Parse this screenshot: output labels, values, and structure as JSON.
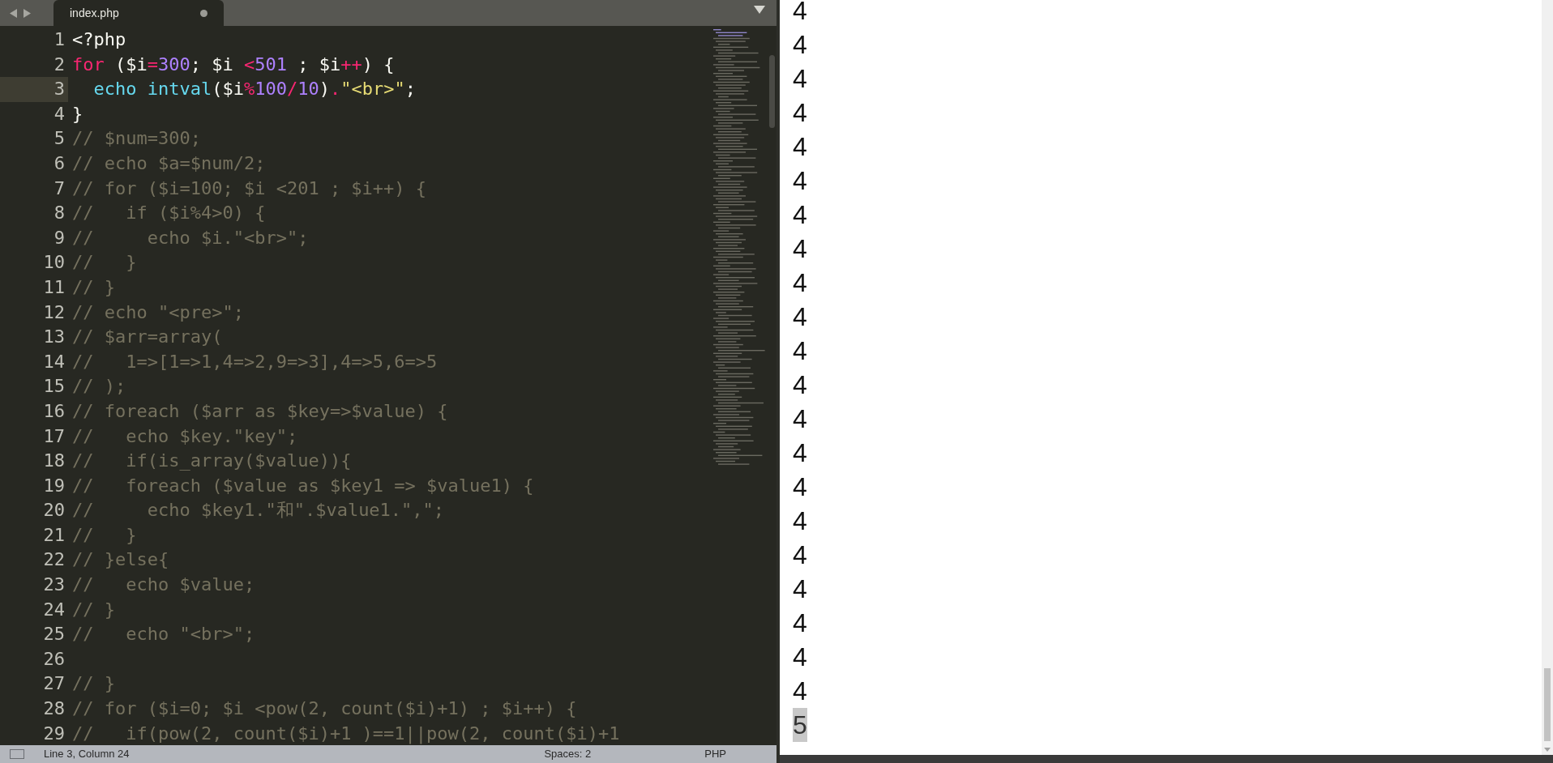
{
  "tabs": [
    {
      "label": "index.php",
      "selected": true,
      "modified": true
    }
  ],
  "editor": {
    "lines": [
      {
        "number": "1",
        "selected": false,
        "tokens": [
          {
            "kind": "plain",
            "text": "<?php"
          }
        ]
      },
      {
        "number": "2",
        "selected": false,
        "tokens": [
          {
            "kind": "keyword",
            "text": "for"
          },
          {
            "kind": "plain",
            "text": " ($i"
          },
          {
            "kind": "keyword",
            "text": "="
          },
          {
            "kind": "number",
            "text": "300"
          },
          {
            "kind": "plain",
            "text": "; $i "
          },
          {
            "kind": "keyword",
            "text": "<"
          },
          {
            "kind": "number",
            "text": "501"
          },
          {
            "kind": "plain",
            "text": " ; $i"
          },
          {
            "kind": "keyword",
            "text": "++"
          },
          {
            "kind": "plain",
            "text": ") {"
          }
        ]
      },
      {
        "number": "3",
        "selected": true,
        "tokens": [
          {
            "kind": "function",
            "text": "  echo"
          },
          {
            "kind": "function",
            "text": " intval"
          },
          {
            "kind": "plain",
            "text": "($i"
          },
          {
            "kind": "keyword",
            "text": "%"
          },
          {
            "kind": "number",
            "text": "100"
          },
          {
            "kind": "keyword",
            "text": "/"
          },
          {
            "kind": "number",
            "text": "10"
          },
          {
            "kind": "plain",
            "text": ")"
          },
          {
            "kind": "keyword",
            "text": "."
          },
          {
            "kind": "string",
            "text": "\"<br>\""
          },
          {
            "kind": "plain",
            "text": ";"
          }
        ]
      },
      {
        "number": "4",
        "selected": false,
        "tokens": [
          {
            "kind": "plain",
            "text": "}"
          }
        ]
      },
      {
        "number": "5",
        "selected": false,
        "tokens": [
          {
            "kind": "comment",
            "text": "// $num=300;"
          }
        ]
      },
      {
        "number": "6",
        "selected": false,
        "tokens": [
          {
            "kind": "comment",
            "text": "// echo $a=$num/2;"
          }
        ]
      },
      {
        "number": "7",
        "selected": false,
        "tokens": [
          {
            "kind": "comment",
            "text": "// for ($i=100; $i <201 ; $i++) {"
          }
        ]
      },
      {
        "number": "8",
        "selected": false,
        "tokens": [
          {
            "kind": "comment",
            "text": "//   if ($i%4>0) {"
          }
        ]
      },
      {
        "number": "9",
        "selected": false,
        "tokens": [
          {
            "kind": "comment",
            "text": "//     echo $i.\"<br>\";"
          }
        ]
      },
      {
        "number": "10",
        "selected": false,
        "tokens": [
          {
            "kind": "comment",
            "text": "//   }"
          }
        ]
      },
      {
        "number": "11",
        "selected": false,
        "tokens": [
          {
            "kind": "comment",
            "text": "// }"
          }
        ]
      },
      {
        "number": "12",
        "selected": false,
        "tokens": [
          {
            "kind": "comment",
            "text": "// echo \"<pre>\";"
          }
        ]
      },
      {
        "number": "13",
        "selected": false,
        "tokens": [
          {
            "kind": "comment",
            "text": "// $arr=array("
          }
        ]
      },
      {
        "number": "14",
        "selected": false,
        "tokens": [
          {
            "kind": "comment",
            "text": "//   1=>[1=>1,4=>2,9=>3],4=>5,6=>5"
          }
        ]
      },
      {
        "number": "15",
        "selected": false,
        "tokens": [
          {
            "kind": "comment",
            "text": "// );"
          }
        ]
      },
      {
        "number": "16",
        "selected": false,
        "tokens": [
          {
            "kind": "comment",
            "text": "// foreach ($arr as $key=>$value) {"
          }
        ]
      },
      {
        "number": "17",
        "selected": false,
        "tokens": [
          {
            "kind": "comment",
            "text": "//   echo $key.\"key\";"
          }
        ]
      },
      {
        "number": "18",
        "selected": false,
        "tokens": [
          {
            "kind": "comment",
            "text": "//   if(is_array($value)){"
          }
        ]
      },
      {
        "number": "19",
        "selected": false,
        "tokens": [
          {
            "kind": "comment",
            "text": "//   foreach ($value as $key1 => $value1) {"
          }
        ]
      },
      {
        "number": "20",
        "selected": false,
        "tokens": [
          {
            "kind": "comment",
            "text": "//     echo $key1.\"和\".$value1.\",\";"
          }
        ]
      },
      {
        "number": "21",
        "selected": false,
        "tokens": [
          {
            "kind": "comment",
            "text": "//   }"
          }
        ]
      },
      {
        "number": "22",
        "selected": false,
        "tokens": [
          {
            "kind": "comment",
            "text": "// }else{"
          }
        ]
      },
      {
        "number": "23",
        "selected": false,
        "tokens": [
          {
            "kind": "comment",
            "text": "//   echo $value;"
          }
        ]
      },
      {
        "number": "24",
        "selected": false,
        "tokens": [
          {
            "kind": "comment",
            "text": "// }"
          }
        ]
      },
      {
        "number": "25",
        "selected": false,
        "tokens": [
          {
            "kind": "comment",
            "text": "//   echo \"<br>\";"
          }
        ]
      },
      {
        "number": "26",
        "selected": false
      },
      {
        "number": "27",
        "selected": false,
        "tokens": [
          {
            "kind": "comment",
            "text": "// }"
          }
        ]
      },
      {
        "number": "28",
        "selected": false,
        "tokens": [
          {
            "kind": "comment",
            "text": "// for ($i=0; $i <pow(2, count($i)+1) ; $i++) {"
          }
        ]
      },
      {
        "number": "29",
        "selected": false,
        "tokens": [
          {
            "kind": "comment",
            "text": "//   if(pow(2, count($i)+1 )==1||pow(2, count($i)+1"
          }
        ]
      }
    ]
  },
  "status_bar": {
    "position": "Line 3, Column 24",
    "indentation": "Spaces: 2",
    "syntax": "PHP"
  },
  "output": {
    "values": [
      {
        "text": "4",
        "selected": false
      },
      {
        "text": "4",
        "selected": false
      },
      {
        "text": "4",
        "selected": false
      },
      {
        "text": "4",
        "selected": false
      },
      {
        "text": "4",
        "selected": false
      },
      {
        "text": "4",
        "selected": false
      },
      {
        "text": "4",
        "selected": false
      },
      {
        "text": "4",
        "selected": false
      },
      {
        "text": "4",
        "selected": false
      },
      {
        "text": "4",
        "selected": false
      },
      {
        "text": "4",
        "selected": false
      },
      {
        "text": "4",
        "selected": false
      },
      {
        "text": "4",
        "selected": false
      },
      {
        "text": "4",
        "selected": false
      },
      {
        "text": "4",
        "selected": false
      },
      {
        "text": "4",
        "selected": false
      },
      {
        "text": "4",
        "selected": false
      },
      {
        "text": "4",
        "selected": false
      },
      {
        "text": "4",
        "selected": false
      },
      {
        "text": "4",
        "selected": false
      },
      {
        "text": "4",
        "selected": false
      },
      {
        "text": "5",
        "selected": true
      }
    ]
  }
}
